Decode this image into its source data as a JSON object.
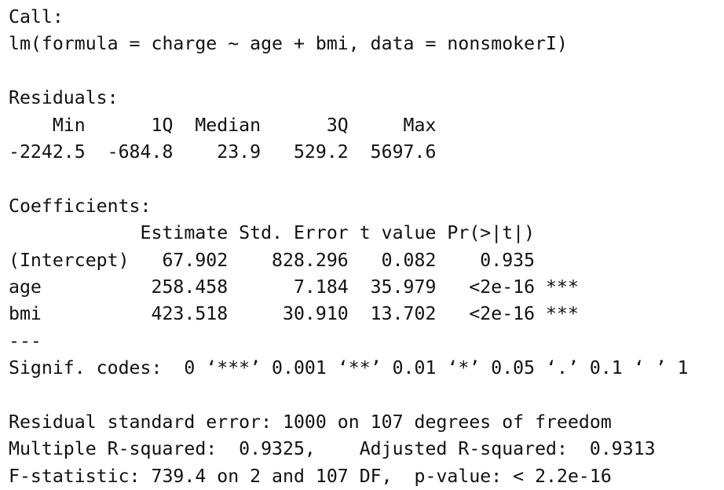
{
  "r_output": {
    "call_header": "Call:",
    "call_formula": "lm(formula = charge ~ age + bmi, data = nonsmokerI)",
    "residuals_header": "Residuals:",
    "residuals_labels": "    Min      1Q  Median      3Q     Max ",
    "residuals_values": "-2242.5  -684.8    23.9   529.2  5697.6 ",
    "coefficients_header": "Coefficients:",
    "coef_columns": "            Estimate Std. Error t value Pr(>|t|)    ",
    "coef_rows": [
      "(Intercept)   67.902    828.296   0.082    0.935    ",
      "age          258.458      7.184  35.979   <2e-16 ***",
      "bmi          423.518     30.910  13.702   <2e-16 ***"
    ],
    "separator": "---",
    "signif_codes": "Signif. codes:  0 ‘***’ 0.001 ‘**’ 0.01 ‘*’ 0.05 ‘.’ 0.1 ‘ ’ 1",
    "residual_se": "Residual standard error: 1000 on 107 degrees of freedom",
    "r_squared": "Multiple R-squared:  0.9325,\tAdjusted R-squared:  0.9313 ",
    "f_statistic": "F-statistic: 739.4 on 2 and 107 DF,  p-value: < 2.2e-16"
  }
}
